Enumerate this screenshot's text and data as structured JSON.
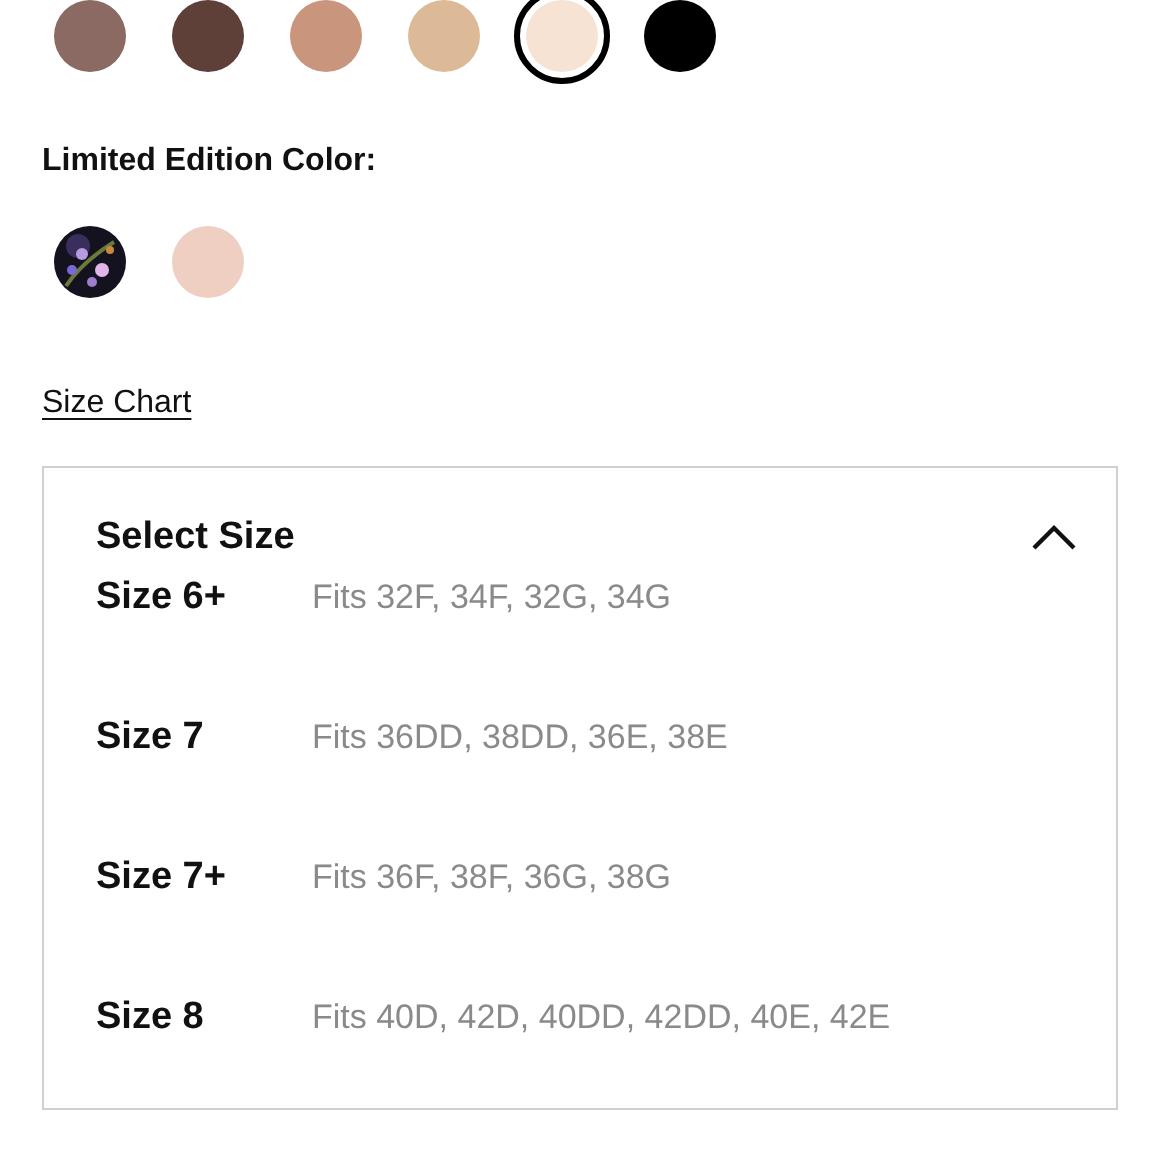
{
  "swatches": [
    {
      "color": "#8a6a62",
      "selected": false
    },
    {
      "color": "#5e4039",
      "selected": false
    },
    {
      "color": "#c9957c",
      "selected": false
    },
    {
      "color": "#dcba98",
      "selected": false
    },
    {
      "color": "#f6e3d3",
      "selected": true
    },
    {
      "color": "#000000",
      "selected": false
    }
  ],
  "limited_heading": "Limited Edition Color:",
  "limited_swatches": [
    {
      "kind": "picture",
      "selected": false
    },
    {
      "kind": "color",
      "color": "#efcfc2",
      "selected": false
    }
  ],
  "size_chart_link": "Size Chart",
  "size_dropdown": {
    "title": "Select Size",
    "expanded": true,
    "options": [
      {
        "label": "Size 6+",
        "fits": "Fits 32F, 34F, 32G, 34G"
      },
      {
        "label": "Size 7",
        "fits": "Fits 36DD, 38DD, 36E, 38E"
      },
      {
        "label": "Size 7+",
        "fits": "Fits 36F, 38F, 36G, 38G"
      },
      {
        "label": "Size 8",
        "fits": "Fits 40D, 42D, 40DD, 42DD, 40E, 42E"
      }
    ]
  }
}
